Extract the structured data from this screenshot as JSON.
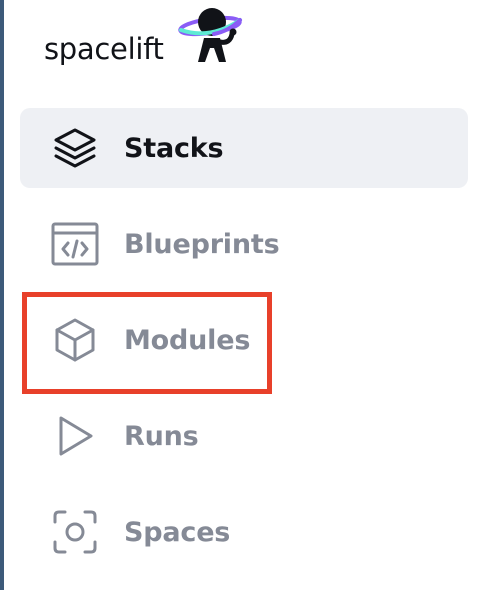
{
  "logo": {
    "text": "spacelift",
    "icon": "astronaut-planet-logo"
  },
  "nav": {
    "items": [
      {
        "label": "Stacks",
        "icon": "layers-icon",
        "active": true
      },
      {
        "label": "Blueprints",
        "icon": "code-window-icon",
        "active": false
      },
      {
        "label": "Modules",
        "icon": "cube-icon",
        "active": false
      },
      {
        "label": "Runs",
        "icon": "play-icon",
        "active": false
      },
      {
        "label": "Spaces",
        "icon": "focus-circle-icon",
        "active": false
      }
    ]
  },
  "colors": {
    "active_background": "#eef0f4",
    "active_text": "#111318",
    "inactive_text": "#858a96",
    "highlight_border": "#e8402a",
    "logo_ring_purple": "#8b5cf6",
    "logo_ring_teal": "#5eead4"
  }
}
